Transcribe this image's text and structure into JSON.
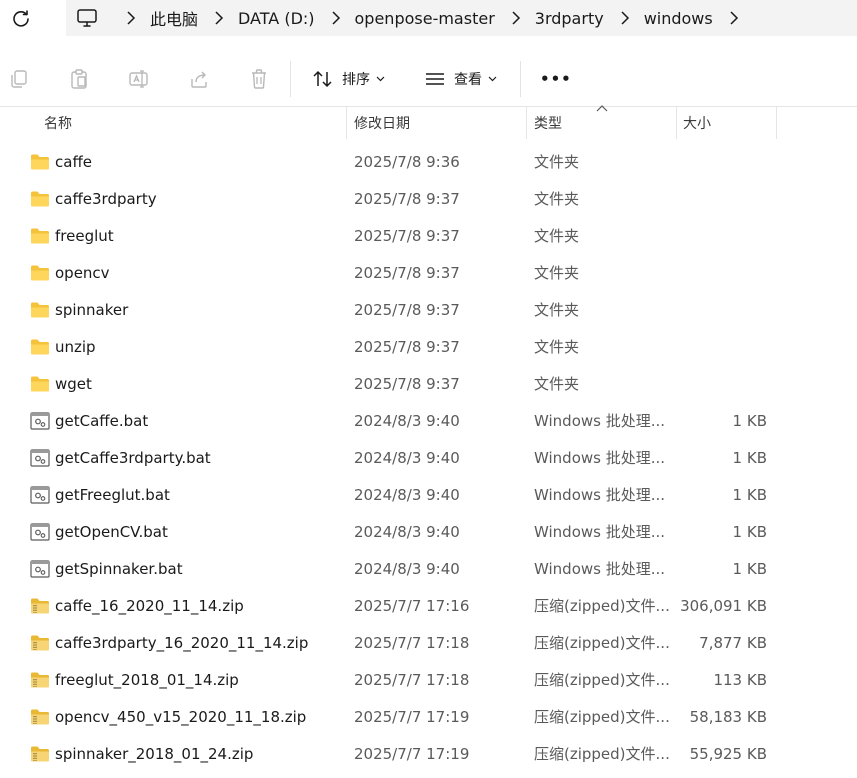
{
  "breadcrumb": [
    "此电脑",
    "DATA (D:)",
    "openpose-master",
    "3rdparty",
    "windows"
  ],
  "toolbar": {
    "sort_label": "排序",
    "view_label": "查看",
    "more_label": "•••"
  },
  "columns": {
    "name": "名称",
    "date": "修改日期",
    "type": "类型",
    "size": "大小"
  },
  "files": [
    {
      "name": "caffe",
      "date": "2025/7/8 9:36",
      "type": "文件夹",
      "size": "",
      "kind": "folder"
    },
    {
      "name": "caffe3rdparty",
      "date": "2025/7/8 9:37",
      "type": "文件夹",
      "size": "",
      "kind": "folder"
    },
    {
      "name": "freeglut",
      "date": "2025/7/8 9:37",
      "type": "文件夹",
      "size": "",
      "kind": "folder"
    },
    {
      "name": "opencv",
      "date": "2025/7/8 9:37",
      "type": "文件夹",
      "size": "",
      "kind": "folder"
    },
    {
      "name": "spinnaker",
      "date": "2025/7/8 9:37",
      "type": "文件夹",
      "size": "",
      "kind": "folder"
    },
    {
      "name": "unzip",
      "date": "2025/7/8 9:37",
      "type": "文件夹",
      "size": "",
      "kind": "folder"
    },
    {
      "name": "wget",
      "date": "2025/7/8 9:37",
      "type": "文件夹",
      "size": "",
      "kind": "folder"
    },
    {
      "name": "getCaffe.bat",
      "date": "2024/8/3 9:40",
      "type": "Windows 批处理...",
      "size": "1 KB",
      "kind": "bat"
    },
    {
      "name": "getCaffe3rdparty.bat",
      "date": "2024/8/3 9:40",
      "type": "Windows 批处理...",
      "size": "1 KB",
      "kind": "bat"
    },
    {
      "name": "getFreeglut.bat",
      "date": "2024/8/3 9:40",
      "type": "Windows 批处理...",
      "size": "1 KB",
      "kind": "bat"
    },
    {
      "name": "getOpenCV.bat",
      "date": "2024/8/3 9:40",
      "type": "Windows 批处理...",
      "size": "1 KB",
      "kind": "bat"
    },
    {
      "name": "getSpinnaker.bat",
      "date": "2024/8/3 9:40",
      "type": "Windows 批处理...",
      "size": "1 KB",
      "kind": "bat"
    },
    {
      "name": "caffe_16_2020_11_14.zip",
      "date": "2025/7/7 17:16",
      "type": "压缩(zipped)文件...",
      "size": "306,091 KB",
      "kind": "zip"
    },
    {
      "name": "caffe3rdparty_16_2020_11_14.zip",
      "date": "2025/7/7 17:18",
      "type": "压缩(zipped)文件...",
      "size": "7,877 KB",
      "kind": "zip"
    },
    {
      "name": "freeglut_2018_01_14.zip",
      "date": "2025/7/7 17:18",
      "type": "压缩(zipped)文件...",
      "size": "113 KB",
      "kind": "zip"
    },
    {
      "name": "opencv_450_v15_2020_11_18.zip",
      "date": "2025/7/7 17:19",
      "type": "压缩(zipped)文件...",
      "size": "58,183 KB",
      "kind": "zip"
    },
    {
      "name": "spinnaker_2018_01_24.zip",
      "date": "2025/7/7 17:19",
      "type": "压缩(zipped)文件...",
      "size": "55,925 KB",
      "kind": "zip"
    }
  ],
  "icons": {
    "refresh": "refresh-icon",
    "pc": "computer-icon",
    "copy": "copy-icon",
    "paste": "paste-icon",
    "rename": "rename-icon",
    "share": "share-icon",
    "delete": "delete-icon",
    "sort": "sort-icon",
    "view": "view-icon",
    "more": "more-icon",
    "folder": "folder-icon",
    "bat": "batch-file-icon",
    "zip": "zip-file-icon"
  },
  "colors": {
    "folder": "#f5c33b",
    "toolbar_disabled": "#b8b8b8",
    "address_bg": "#f3f3f3"
  }
}
